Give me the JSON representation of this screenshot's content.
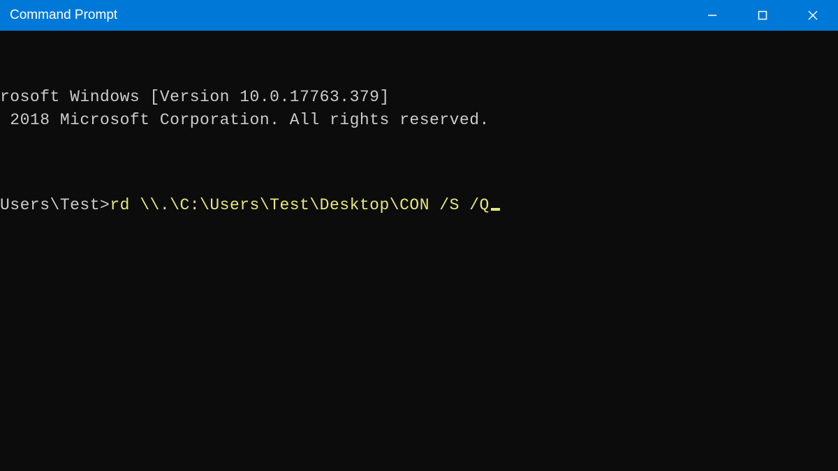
{
  "window": {
    "title": "Command Prompt"
  },
  "terminal": {
    "line1": "rosoft Windows [Version 10.0.17763.379]",
    "line2": " 2018 Microsoft Corporation. All rights reserved.",
    "prompt": "Users\\Test>",
    "command": "rd \\\\.\\C:\\Users\\Test\\Desktop\\CON /S /Q"
  },
  "colors": {
    "titlebar": "#0078d7",
    "terminal_bg": "#0c0c0c",
    "terminal_fg": "#cccccc",
    "command_fg": "#e8e87a"
  }
}
